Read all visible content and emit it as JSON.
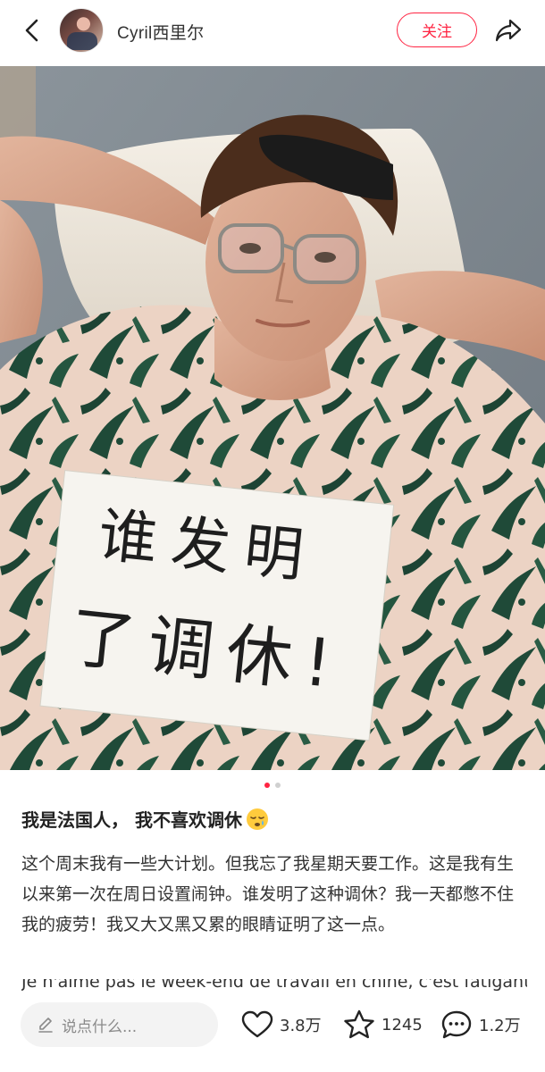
{
  "header": {
    "back_icon": "chevron-left-icon",
    "username": "Cyril西里尔",
    "follow_label": "关注",
    "share_icon": "share-arrow-icon",
    "accent_color": "#ff2442"
  },
  "media": {
    "sign_text_line1": "谁发明",
    "sign_text_line2": "了调休!",
    "page_indicator": {
      "total": 2,
      "current": 1
    }
  },
  "post": {
    "title": "我是法国人， 我不喜欢调休",
    "title_emoji": "sleepy-face-emoji",
    "body": "这个周末我有一些大计划。但我忘了我星期天要工作。这是我有生以来第一次在周日设置闹钟。谁发明了这种调休？我一天都憋不住我的疲劳！我又大又黑又累的眼睛证明了这一点。",
    "more_text": "Je n'aime pas le week-end de travail en chine, c'est fatigant..."
  },
  "bottom_bar": {
    "comment_placeholder": "说点什么...",
    "likes": "3.8万",
    "stars": "1245",
    "comments": "1.2万"
  }
}
